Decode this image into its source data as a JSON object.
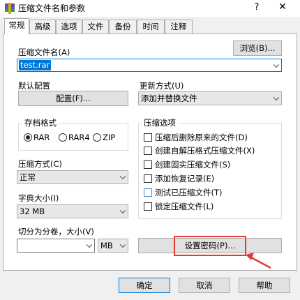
{
  "window": {
    "title": "压缩文件名和参数",
    "help_symbol": "?",
    "close_symbol": "✕"
  },
  "tabs": [
    {
      "label": "常规"
    },
    {
      "label": "高级"
    },
    {
      "label": "选项"
    },
    {
      "label": "文件"
    },
    {
      "label": "备份"
    },
    {
      "label": "时间"
    },
    {
      "label": "注释"
    }
  ],
  "archive": {
    "label": "压缩文件名(A)",
    "value": "test.rar",
    "browse_label": "浏览(B)..."
  },
  "profile": {
    "label": "默认配置",
    "button_label": "配置(F)..."
  },
  "update_mode": {
    "label": "更新方式(U)",
    "value": "添加并替换文件"
  },
  "format": {
    "label": "存档格式",
    "options": [
      "RAR",
      "RAR4",
      "ZIP"
    ],
    "selected": "RAR"
  },
  "method": {
    "label": "压缩方式(C)",
    "value": "正常"
  },
  "dictionary": {
    "label": "字典大小(I)",
    "value": "32 MB"
  },
  "split": {
    "label": "切分为分卷，大小(V)",
    "value": "",
    "unit": "MB"
  },
  "options": {
    "label": "压缩选项",
    "items": [
      {
        "label": "压缩后删除原来的文件(D)",
        "checked": false
      },
      {
        "label": "创建自解压格式压缩文件(X)",
        "checked": false
      },
      {
        "label": "创建固实压缩文件(S)",
        "checked": false
      },
      {
        "label": "添加恢复记录(E)",
        "checked": false
      },
      {
        "label": "测试已压缩文件(T)",
        "checked": false
      },
      {
        "label": "锁定压缩文件(L)",
        "checked": false
      }
    ]
  },
  "password_button": "设置密码(P)...",
  "footer": {
    "ok": "确定",
    "cancel": "取消",
    "help": "帮助"
  },
  "colors": {
    "highlight_rect": "#e53935",
    "arrow": "#e53935",
    "selection": "#0078d7"
  }
}
